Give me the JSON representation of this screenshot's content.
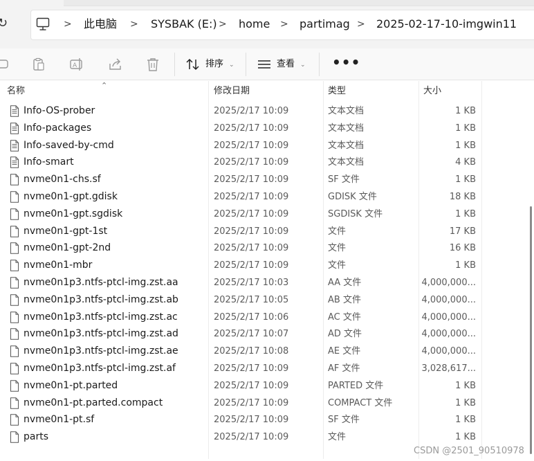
{
  "breadcrumb": [
    "此电脑",
    "SYSBAK (E:)",
    "home",
    "partimag",
    "2025-02-17-10-imgwin11"
  ],
  "toolbar": {
    "sort_label": "排序",
    "view_label": "查看",
    "more_label": "•••"
  },
  "columns": {
    "name": "名称",
    "date": "修改日期",
    "type": "类型",
    "size": "大小"
  },
  "files": [
    {
      "name": "Info-OS-prober",
      "date": "2025/2/17 10:09",
      "type": "文本文档",
      "size": "1 KB",
      "icon": "text-document-icon"
    },
    {
      "name": "Info-packages",
      "date": "2025/2/17 10:09",
      "type": "文本文档",
      "size": "1 KB",
      "icon": "text-document-icon"
    },
    {
      "name": "Info-saved-by-cmd",
      "date": "2025/2/17 10:09",
      "type": "文本文档",
      "size": "1 KB",
      "icon": "text-document-icon"
    },
    {
      "name": "Info-smart",
      "date": "2025/2/17 10:09",
      "type": "文本文档",
      "size": "4 KB",
      "icon": "text-document-icon"
    },
    {
      "name": "nvme0n1-chs.sf",
      "date": "2025/2/17 10:09",
      "type": "SF 文件",
      "size": "1 KB",
      "icon": "file-icon"
    },
    {
      "name": "nvme0n1-gpt.gdisk",
      "date": "2025/2/17 10:09",
      "type": "GDISK 文件",
      "size": "18 KB",
      "icon": "file-icon"
    },
    {
      "name": "nvme0n1-gpt.sgdisk",
      "date": "2025/2/17 10:09",
      "type": "SGDISK 文件",
      "size": "1 KB",
      "icon": "file-icon"
    },
    {
      "name": "nvme0n1-gpt-1st",
      "date": "2025/2/17 10:09",
      "type": "文件",
      "size": "17 KB",
      "icon": "file-icon"
    },
    {
      "name": "nvme0n1-gpt-2nd",
      "date": "2025/2/17 10:09",
      "type": "文件",
      "size": "16 KB",
      "icon": "file-icon"
    },
    {
      "name": "nvme0n1-mbr",
      "date": "2025/2/17 10:09",
      "type": "文件",
      "size": "1 KB",
      "icon": "file-icon"
    },
    {
      "name": "nvme0n1p3.ntfs-ptcl-img.zst.aa",
      "date": "2025/2/17 10:03",
      "type": "AA 文件",
      "size": "4,000,000...",
      "icon": "file-icon"
    },
    {
      "name": "nvme0n1p3.ntfs-ptcl-img.zst.ab",
      "date": "2025/2/17 10:05",
      "type": "AB 文件",
      "size": "4,000,000...",
      "icon": "file-icon"
    },
    {
      "name": "nvme0n1p3.ntfs-ptcl-img.zst.ac",
      "date": "2025/2/17 10:06",
      "type": "AC 文件",
      "size": "4,000,000...",
      "icon": "file-icon"
    },
    {
      "name": "nvme0n1p3.ntfs-ptcl-img.zst.ad",
      "date": "2025/2/17 10:07",
      "type": "AD 文件",
      "size": "4,000,000...",
      "icon": "file-icon"
    },
    {
      "name": "nvme0n1p3.ntfs-ptcl-img.zst.ae",
      "date": "2025/2/17 10:08",
      "type": "AE 文件",
      "size": "4,000,000...",
      "icon": "file-icon"
    },
    {
      "name": "nvme0n1p3.ntfs-ptcl-img.zst.af",
      "date": "2025/2/17 10:09",
      "type": "AF 文件",
      "size": "3,028,617...",
      "icon": "file-icon"
    },
    {
      "name": "nvme0n1-pt.parted",
      "date": "2025/2/17 10:09",
      "type": "PARTED 文件",
      "size": "1 KB",
      "icon": "file-icon"
    },
    {
      "name": "nvme0n1-pt.parted.compact",
      "date": "2025/2/17 10:09",
      "type": "COMPACT 文件",
      "size": "1 KB",
      "icon": "file-icon"
    },
    {
      "name": "nvme0n1-pt.sf",
      "date": "2025/2/17 10:09",
      "type": "SF 文件",
      "size": "1 KB",
      "icon": "file-icon"
    },
    {
      "name": "parts",
      "date": "2025/2/17 10:09",
      "type": "文件",
      "size": "1 KB",
      "icon": "file-icon"
    }
  ],
  "watermark": "CSDN @2501_90510978"
}
